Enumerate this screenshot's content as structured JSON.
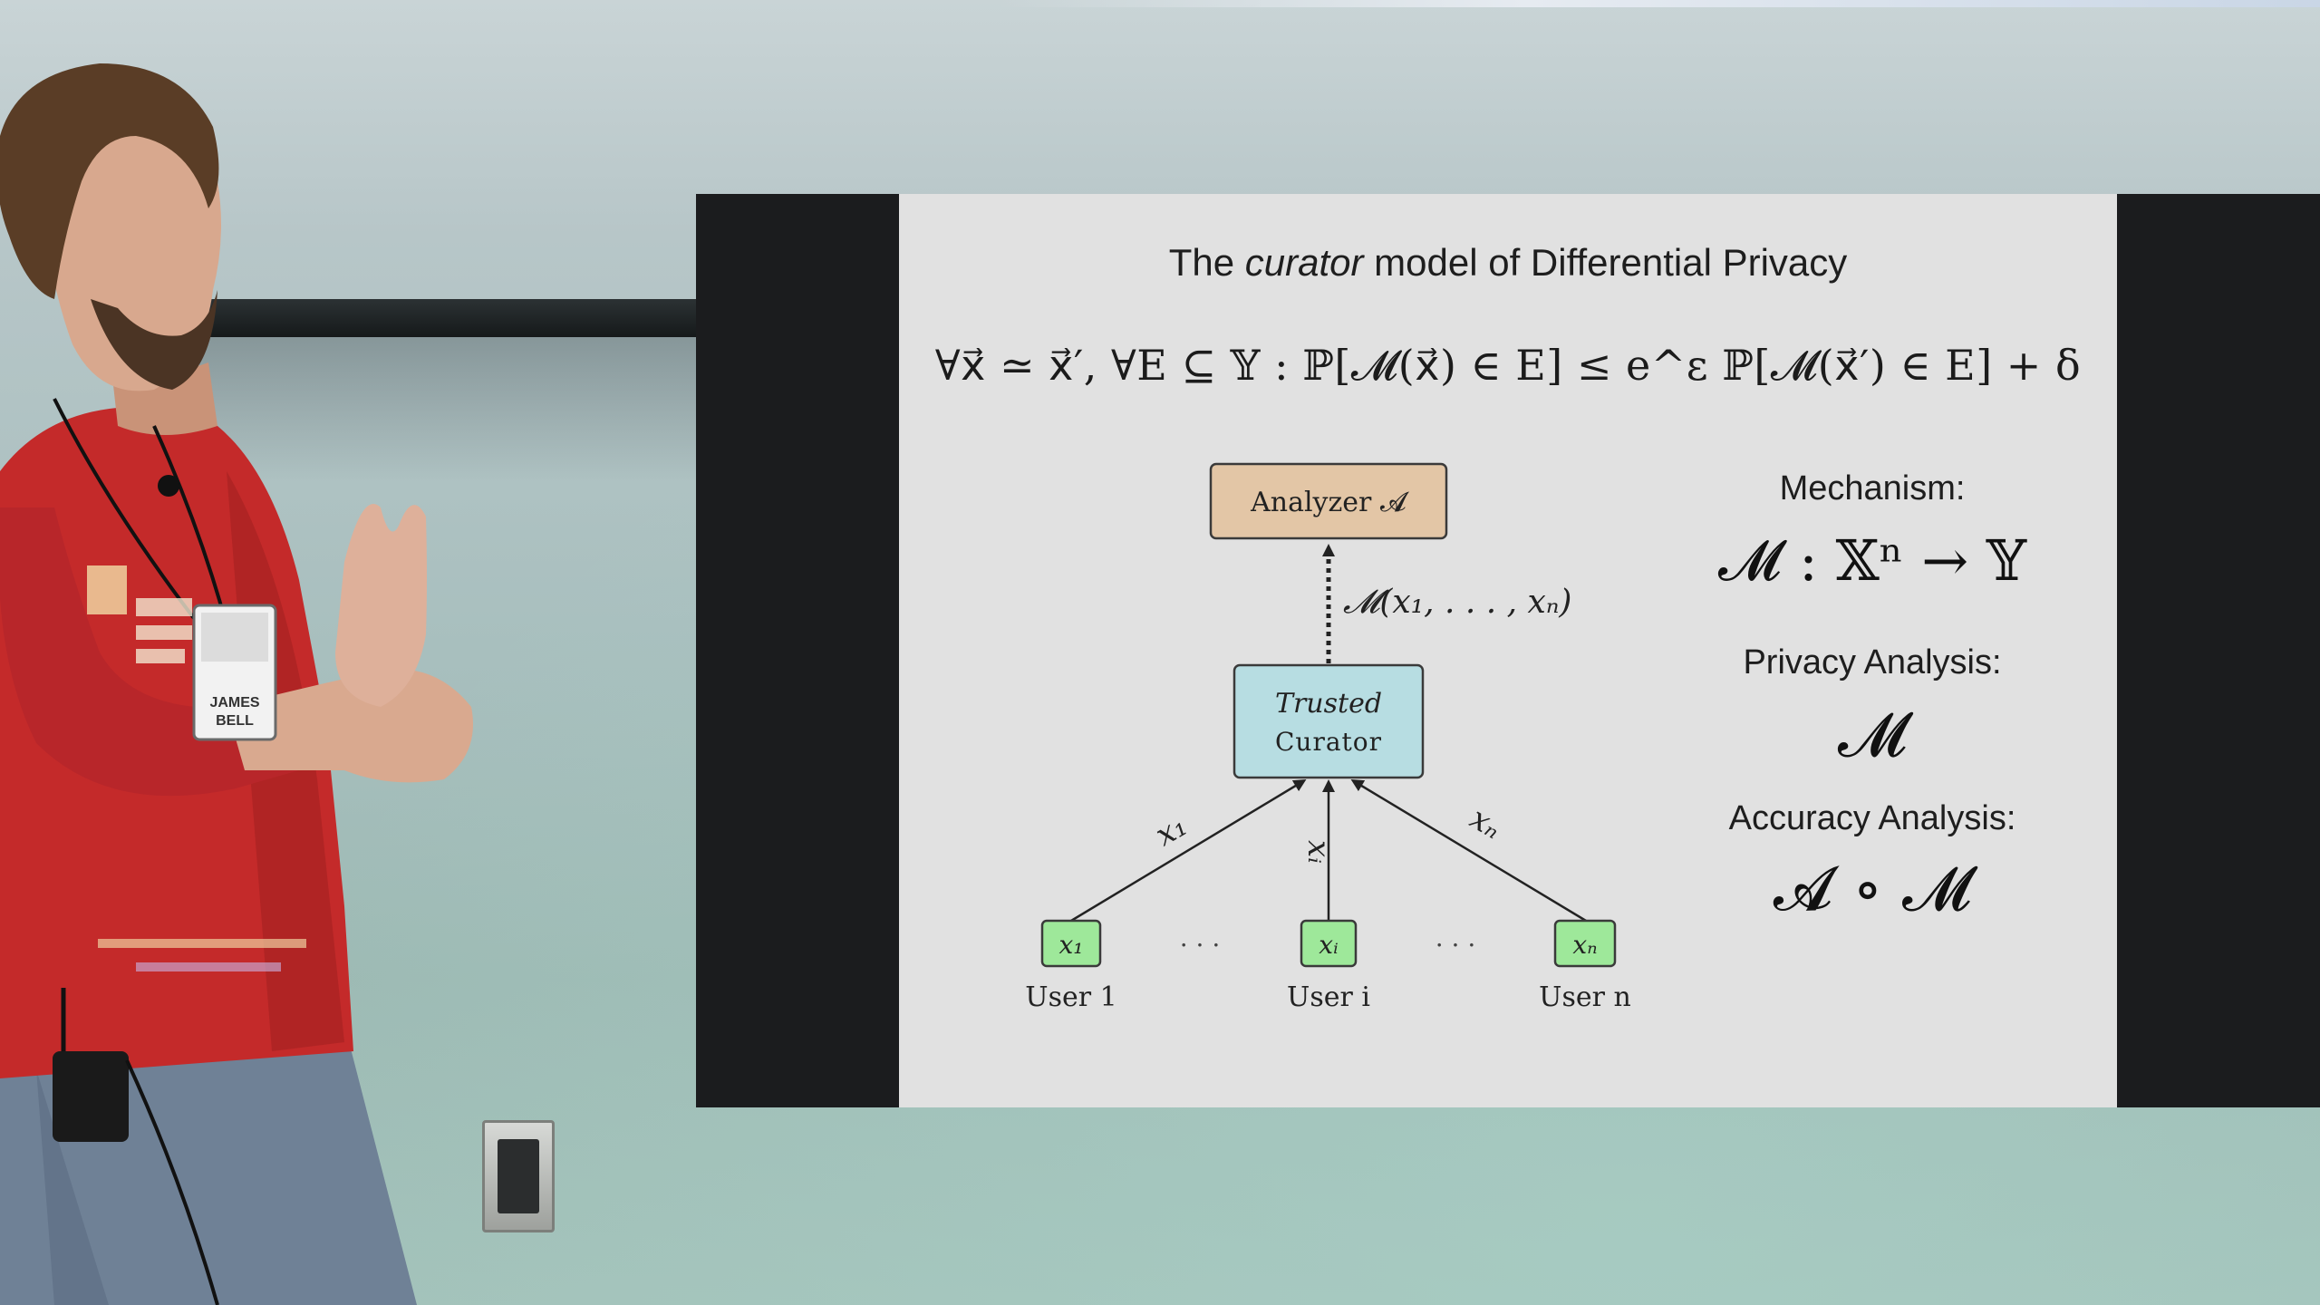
{
  "slide": {
    "title_pre": "The ",
    "title_em": "curator",
    "title_post": " model of Differential Privacy",
    "formula": "∀x⃗ ≃ x⃗′, ∀E ⊆ 𝕐 :  ℙ[𝓜(x⃗) ∈ E] ≤ e^ε ℙ[𝓜(x⃗′) ∈ E] + δ",
    "analyzer_label": "Analyzer 𝓐",
    "mechanism_edge_label": "𝓜(x₁, . . . , xₙ)",
    "curator_line1": "Trusted",
    "curator_line2": "Curator",
    "edges": [
      "x₁",
      "xᵢ",
      "xₙ"
    ],
    "users": [
      {
        "box": "x₁",
        "label": "User 1"
      },
      {
        "box": "xᵢ",
        "label": "User i"
      },
      {
        "box": "xₙ",
        "label": "User n"
      }
    ],
    "dots": ". . .",
    "mechanism_heading": "Mechanism:",
    "mechanism_math": "𝓜 : 𝕏ⁿ → 𝕐",
    "privacy_heading": "Privacy Analysis:",
    "privacy_math": "𝓜",
    "accuracy_heading": "Accuracy Analysis:",
    "accuracy_math": "𝓐 ∘ 𝓜"
  },
  "badge": {
    "name_line1": "JAMES",
    "name_line2": "BELL"
  },
  "colors": {
    "analyzer_fill": "#e3c6a6",
    "curator_fill": "#b7dde2",
    "user_fill": "#9ee89a",
    "shirt": "#c92a2a",
    "slide_bg": "#e1e1e1"
  }
}
